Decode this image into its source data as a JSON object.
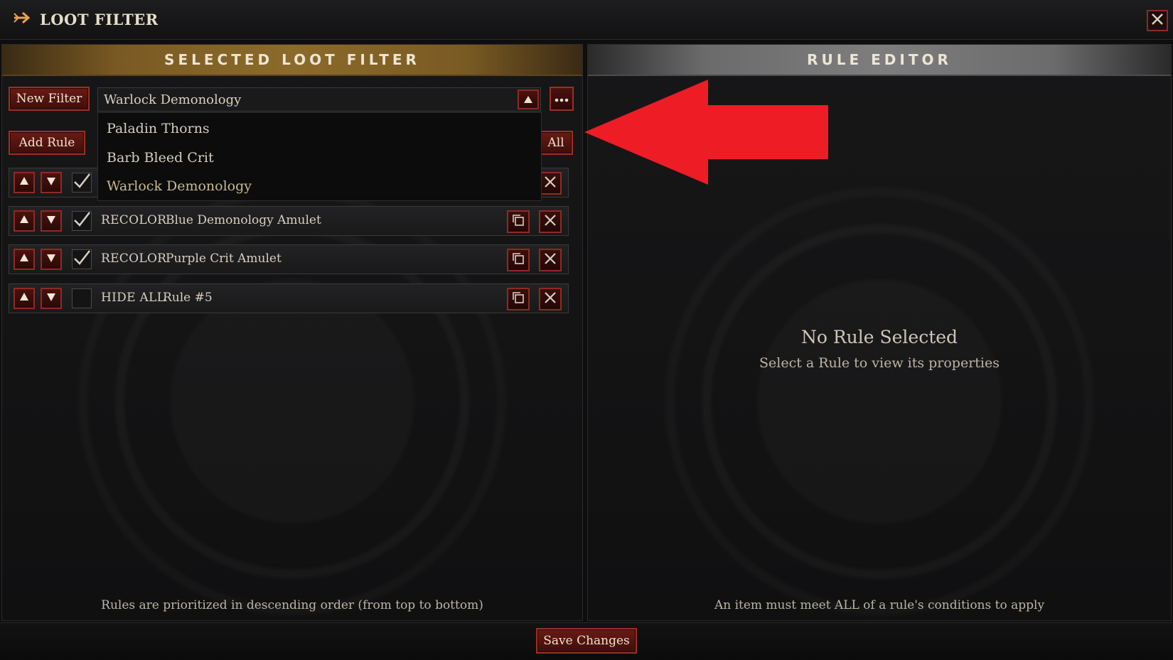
{
  "window": {
    "title": "LOOT FILTER"
  },
  "left_panel": {
    "header": "SELECTED LOOT FILTER",
    "new_filter_label": "New Filter",
    "add_rule_label": "Add Rule",
    "all_label": "All",
    "selected_filter": "Warlock Demonology",
    "filter_options": [
      "Paladin Thorns",
      "Barb Bleed Crit",
      "Warlock Demonology"
    ],
    "rules": [
      {
        "action": "RECOLOR",
        "name": "Blue Demonology Amulet",
        "enabled": true
      },
      {
        "action": "RECOLOR",
        "name": "Purple Crit Amulet",
        "enabled": true
      },
      {
        "action": "HIDE ALL",
        "name": "Rule #5",
        "enabled": false
      }
    ],
    "footer_hint": "Rules are prioritized in descending order (from top to bottom)"
  },
  "right_panel": {
    "header": "RULE EDITOR",
    "empty_title": "No Rule Selected",
    "empty_subtitle": "Select a Rule to view its properties",
    "footer_hint": "An item must meet ALL of a rule's conditions to apply"
  },
  "save_label": "Save Changes",
  "colors": {
    "accent_red": "#9a3025",
    "annotation_arrow": "#ee1c25",
    "gold_header": "#8c6a2b"
  },
  "icons": {
    "title": "arrow-right-icon",
    "close": "close-icon",
    "toggle": "caret-up-icon",
    "more": "ellipsis-icon",
    "move_up": "triangle-up-icon",
    "move_down": "triangle-down-icon",
    "check": "checkmark-icon",
    "copy": "copy-icon",
    "delete": "x-icon"
  }
}
